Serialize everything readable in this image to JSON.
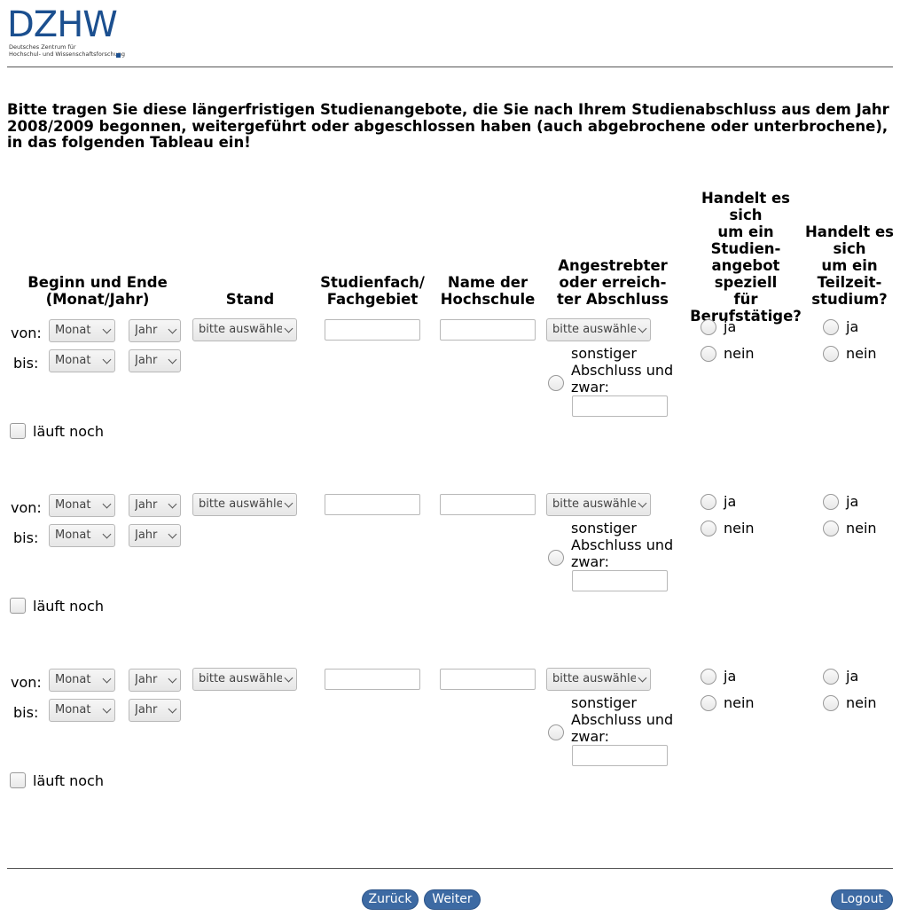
{
  "logo": {
    "mark": "DZHW",
    "line1": "Deutsches Zentrum für",
    "line2": "Hochschul- und Wissenschaftsforschung"
  },
  "question": "Bitte tragen Sie diese längerfristigen Studienangebote, die Sie nach Ihrem Studienabschluss aus dem Jahr 2008/2009 begonnen, weitergeführt oder abgeschlossen haben (auch abgebrochene oder unterbrochene), in das folgenden Tableau ein!",
  "columns": {
    "begin_end": "Beginn und Ende\n(Monat/Jahr)",
    "stand": "Stand",
    "fach": "Studienfach/\nFachgebiet",
    "hochschule": "Name der\nHochschule",
    "abschluss": "Angestrebter\noder erreich-\nter Abschluss",
    "berufs": "Handelt es sich\num ein\nStudien-\nangebot\nspeziell\nfür\nBerufstätige?",
    "teilzeit": "Handelt es\nsich\num ein\nTeilzeit-\nstudium?"
  },
  "row_labels": {
    "von": "von:",
    "bis": "bis:",
    "laeuft_noch": "läuft noch",
    "monat": "Monat",
    "jahr": "Jahr",
    "bitte": "bitte auswählen",
    "sonstiger": "sonstiger\nAbschluss und\nzwar:",
    "ja": "ja",
    "nein": "nein"
  },
  "buttons": {
    "back": "Zurück",
    "next": "Weiter",
    "logout": "Logout"
  }
}
